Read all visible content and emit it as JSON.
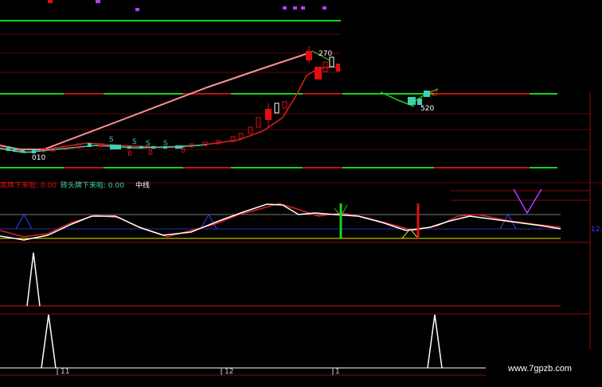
{
  "colors": {
    "bg": "#000000",
    "grid_red": "#8a0d0d",
    "green_line": "#19d419",
    "up_candle": "#e01010",
    "down_candle": "#3fd0b0",
    "ma_pink": "#ff9090",
    "ma_red": "#e02020",
    "white_line": "#ffffff",
    "blue_line": "#3344ff",
    "yellow_line": "#e8e800",
    "violet": "#b040ff"
  },
  "price_labels": {
    "peak": "270",
    "low": "010",
    "right_low": "520"
  },
  "signal_marks": [
    "S",
    "S",
    "S",
    "S",
    "B",
    "B",
    "B"
  ],
  "indicator_header": {
    "item1": "底牌下来啦: 0.00",
    "item2": "砖头牌下来啦: 0.00",
    "item3": "中线"
  },
  "right_axis_value": "12.",
  "x_ticks": [
    "11",
    "12",
    "1"
  ],
  "watermark": "www.7gpzb.com"
}
